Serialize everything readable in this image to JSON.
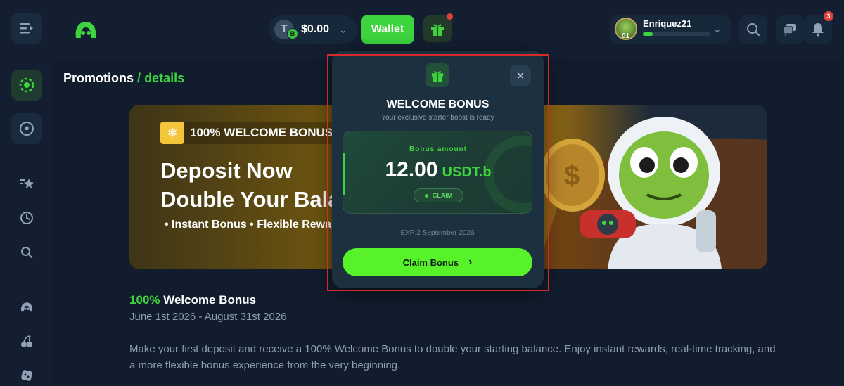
{
  "header": {
    "balance": "$0.00",
    "token_letter": "T",
    "token_sub": "B",
    "wallet_label": "Wallet",
    "username": "Enriquez21",
    "level": "01",
    "xp_fraction": 0.15,
    "notification_count": "3",
    "chevron": "⌄"
  },
  "breadcrumb": {
    "root": "Promotions",
    "separator": "/",
    "current": "details"
  },
  "banner": {
    "tag_icon": "❄",
    "tag_text": "100% WELCOME BONUS",
    "headline_1": "Deposit Now",
    "headline_2": "Double Your Balance",
    "bullets": "•  Instant Bonus  •  Flexible Rewards"
  },
  "promo": {
    "percent": "100%",
    "title_rest": " Welcome Bonus",
    "dates": "June 1st 2026 - August 31st 2026",
    "description": "Make your first deposit and receive a 100% Welcome Bonus to double your starting balance. Enjoy instant rewards, real-time tracking, and a more flexible bonus experience from the very beginning."
  },
  "modal": {
    "close": "✕",
    "title": "WELCOME BONUS",
    "subtitle": "Your exclusive starter boost is ready",
    "bonus_label": "Bonus amount",
    "bonus_value": "12.00",
    "bonus_currency": "USDT.b",
    "chip_label": "CLAIM",
    "expiry": "EXP:2 September 2026",
    "claim_button": "Claim Bonus",
    "claim_chevron": "›"
  },
  "colors": {
    "accent": "#3ed43f",
    "background": "#111c2d",
    "highlight": "#d42a2a"
  },
  "icons": {
    "sidebar": [
      "menu-icon",
      "casino-chip-icon",
      "sports-ball-icon",
      "star-icon",
      "clock-icon",
      "search-icon",
      "logo-icon",
      "cherries-icon",
      "dice-icon"
    ],
    "header": [
      "search-icon",
      "chat-icon",
      "bell-icon",
      "gift-icon"
    ]
  }
}
